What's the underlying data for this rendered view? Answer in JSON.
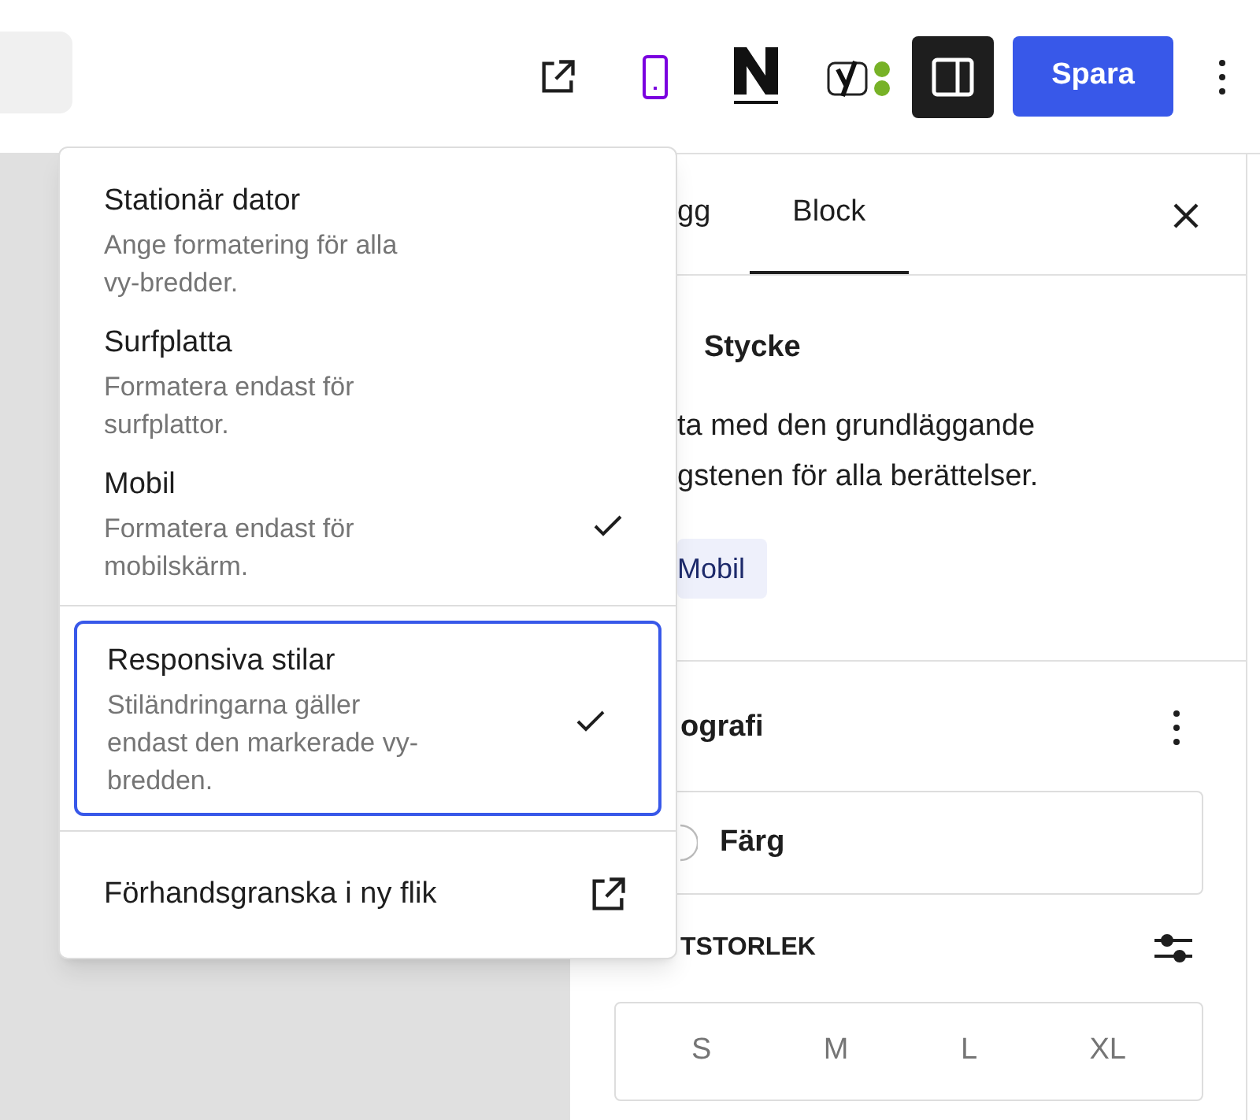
{
  "toolbar": {
    "device_preview_active": true,
    "sidebar_toggle_pressed": true,
    "save_label": "Spara"
  },
  "sidebar": {
    "tabs": [
      {
        "label": "gg",
        "selected": false
      },
      {
        "label": "Block",
        "selected": true
      }
    ],
    "block": {
      "title": "Stycke",
      "description_lines": [
        "ta med den grundläggande",
        "gstenen för alla berättelser."
      ],
      "badge": "Mobil"
    },
    "typography": {
      "title": "ografi",
      "color_label": "Färg",
      "font_size_label": "TSTORLEK",
      "sizes": [
        "S",
        "M",
        "L",
        "XL"
      ]
    }
  },
  "menu": {
    "devices": [
      {
        "title": "Stationär dator",
        "description_lines": [
          "Ange formatering för alla",
          "vy-bredder."
        ],
        "checked": false
      },
      {
        "title": "Surfplatta",
        "description_lines": [
          "Formatera endast för",
          "surfplattor."
        ],
        "checked": false
      },
      {
        "title": "Mobil",
        "description_lines": [
          "Formatera endast för",
          "mobilskärm."
        ],
        "checked": true
      }
    ],
    "responsive": {
      "title": "Responsiva stilar",
      "description_lines": [
        "Stiländringarna gäller",
        "endast den markerade vy-",
        "bredden."
      ],
      "checked": true,
      "focused": true
    },
    "preview_label": "Förhandsgranska i ny flik"
  }
}
